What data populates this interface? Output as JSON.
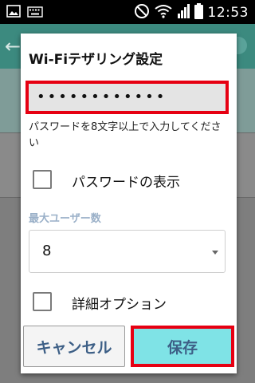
{
  "status_bar": {
    "time": "12:53",
    "icons": [
      "image-icon",
      "keyboard-icon",
      "do-not-disturb-icon",
      "wifi-icon",
      "signal-icon",
      "battery-icon"
    ]
  },
  "dialog": {
    "title": "Wi-Fiテザリング設定",
    "password": {
      "value": "••••••••••••",
      "hint": "パスワードを8文字以上で入力してください"
    },
    "show_password": {
      "label": "パスワードの表示",
      "checked": false
    },
    "max_users": {
      "label": "最大ユーザー数",
      "selected": "8"
    },
    "advanced_options": {
      "label": "詳細オプション",
      "checked": false
    },
    "buttons": {
      "cancel": "キャンセル",
      "save": "保存"
    }
  },
  "colors": {
    "highlight": "#e60012",
    "save_button": "#7fe3e6",
    "button_text": "#3d5f86",
    "section_label": "#9ab0c8",
    "header": "#3c8a7f"
  }
}
